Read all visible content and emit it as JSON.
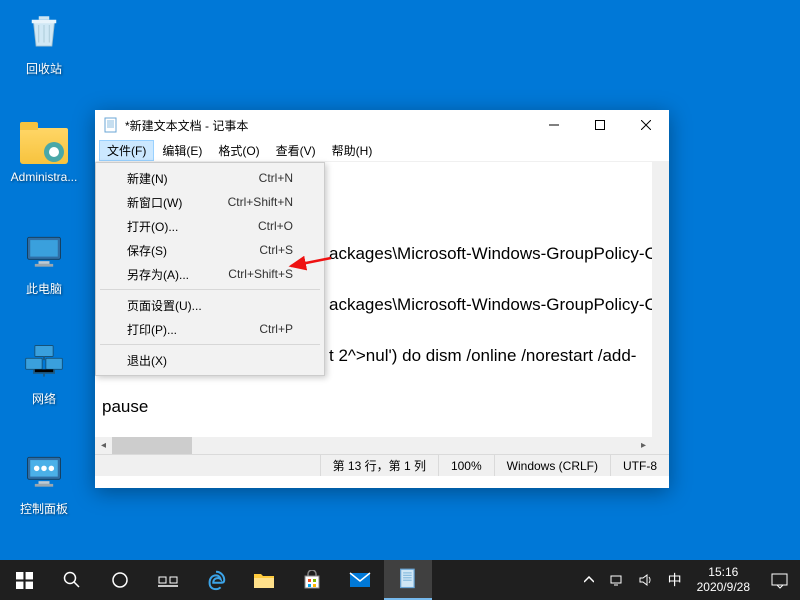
{
  "desktop": {
    "icons": [
      {
        "label": "回收站"
      },
      {
        "label": "Administra..."
      },
      {
        "label": "此电脑"
      },
      {
        "label": "网络"
      },
      {
        "label": "控制面板"
      }
    ]
  },
  "window": {
    "title": "*新建文本文档 - 记事本",
    "menubar": [
      "文件(F)",
      "编辑(E)",
      "格式(O)",
      "查看(V)",
      "帮助(H)"
    ],
    "content_lines": [
      "",
      "",
      "",
      "ackages\\Microsoft-Windows-GroupPolicy-C",
      "",
      "ackages\\Microsoft-Windows-GroupPolicy-C",
      "",
      "t 2^>nul') do dism /online /norestart /add-",
      "",
      "pause",
      "",
      ""
    ],
    "statusbar": {
      "position": "第 13 行，第 1 列",
      "zoom": "100%",
      "lineending": "Windows (CRLF)",
      "encoding": "UTF-8"
    }
  },
  "file_menu": [
    {
      "label": "新建(N)",
      "shortcut": "Ctrl+N"
    },
    {
      "label": "新窗口(W)",
      "shortcut": "Ctrl+Shift+N"
    },
    {
      "label": "打开(O)...",
      "shortcut": "Ctrl+O"
    },
    {
      "label": "保存(S)",
      "shortcut": "Ctrl+S"
    },
    {
      "label": "另存为(A)...",
      "shortcut": "Ctrl+Shift+S"
    },
    {
      "sep": true
    },
    {
      "label": "页面设置(U)...",
      "shortcut": ""
    },
    {
      "label": "打印(P)...",
      "shortcut": "Ctrl+P"
    },
    {
      "sep": true
    },
    {
      "label": "退出(X)",
      "shortcut": ""
    }
  ],
  "tray": {
    "ime": "中",
    "time": "15:16",
    "date": "2020/9/28"
  }
}
